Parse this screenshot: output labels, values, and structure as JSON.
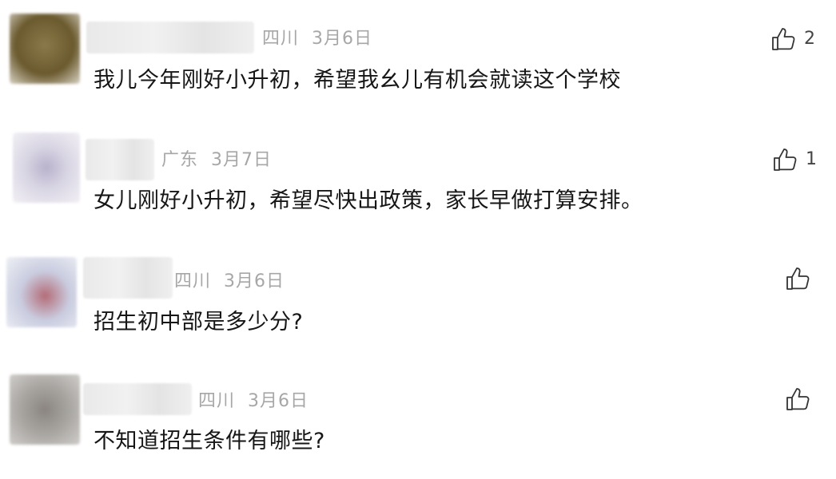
{
  "comments": [
    {
      "region": "四川",
      "date": "3月6日",
      "text": "我儿今年刚好小升初，希望我幺儿有机会就读这个学校",
      "likes": "2",
      "avatar_colors": [
        "#8a7a4a",
        "#6b5a2e"
      ]
    },
    {
      "region": "广东",
      "date": "3月7日",
      "text": "女儿刚好小升初，希望尽快出政策，家长早做打算安排。",
      "likes": "1",
      "avatar_colors": [
        "#d9d6e4",
        "#b9b2cc"
      ]
    },
    {
      "region": "四川",
      "date": "3月6日",
      "text": "招生初中部是多少分?",
      "likes": "",
      "avatar_colors": [
        "#c9ccdf",
        "#b36d78"
      ]
    },
    {
      "region": "四川",
      "date": "3月6日",
      "text": "不知道招生条件有哪些?",
      "likes": "",
      "avatar_colors": [
        "#a9a6a2",
        "#8a8580"
      ]
    }
  ],
  "icons": {
    "like": "thumbs-up-icon"
  }
}
